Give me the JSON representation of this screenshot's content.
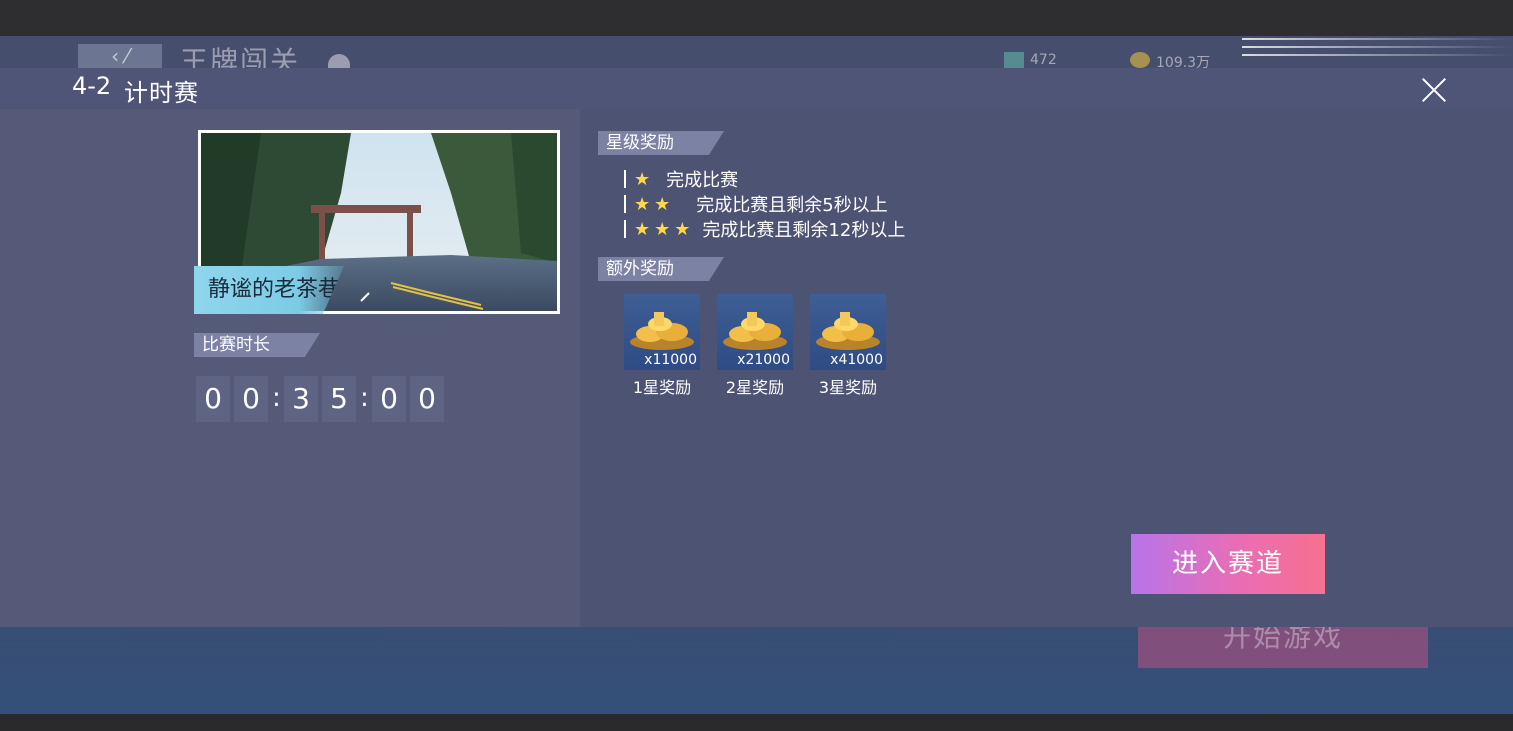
{
  "background": {
    "title": "王牌闯关",
    "currency_1": "472",
    "currency_2": "109.3万",
    "start_button": "开始游戏"
  },
  "modal": {
    "stage_code": "4-2",
    "stage_name": "计时赛",
    "close_icon": "close-icon",
    "track_name": "静谧的老茶巷",
    "duration_label": "比赛时长",
    "timer_digits": [
      "0",
      "0",
      "3",
      "5",
      "0",
      "0"
    ],
    "timer_separator": ":",
    "star_rewards_label": "星级奖励",
    "star_rewards": [
      {
        "stars": 1,
        "desc": "完成比赛"
      },
      {
        "stars": 2,
        "desc": "完成比赛且剩余5秒以上"
      },
      {
        "stars": 3,
        "desc": "完成比赛且剩余12秒以上"
      }
    ],
    "extra_rewards_label": "额外奖励",
    "extra_rewards": [
      {
        "qty": "x11000",
        "label": "1星奖励",
        "icon": "gold-coins-icon"
      },
      {
        "qty": "x21000",
        "label": "2星奖励",
        "icon": "gold-coins-icon"
      },
      {
        "qty": "x41000",
        "label": "3星奖励",
        "icon": "gold-coins-icon"
      }
    ],
    "enter_button": "进入赛道"
  },
  "colors": {
    "accent_gradient_start": "#b774ea",
    "accent_gradient_end": "#f6708f",
    "star": "#ffd84a",
    "track_tag": "#8fd6ec"
  }
}
